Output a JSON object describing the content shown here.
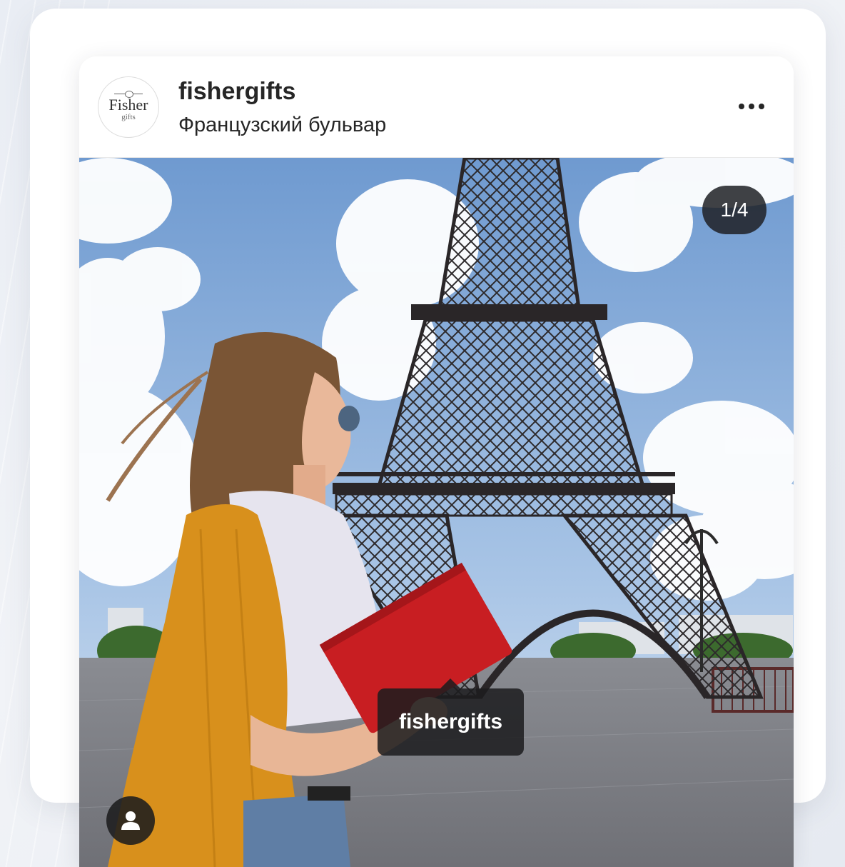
{
  "post": {
    "username": "fishergifts",
    "location": "Французский бульвар",
    "avatar": {
      "brand": "Fisher",
      "sub": "gifts"
    },
    "more_icon": "more-horizontal-icon",
    "photo_counter": "1/4",
    "product_tag": "fishergifts",
    "tags_icon": "user-tag-icon"
  },
  "colors": {
    "text": "#262626",
    "overlay": "#1c1c1e",
    "sky": "#7fa8d8",
    "cardigan": "#d9901a",
    "notebook": "#c81e22"
  }
}
